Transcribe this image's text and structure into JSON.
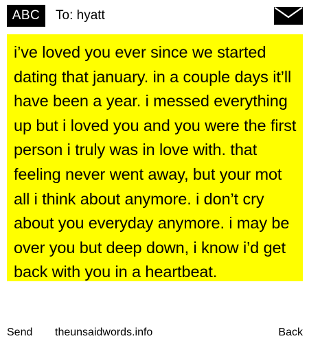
{
  "header": {
    "mode_badge": "ABC",
    "recipient": "To: hyatt",
    "send_icon": "envelope-icon"
  },
  "message": {
    "body": "i’ve loved you ever since we started dating that january. in a couple days it’ll have been a year. i messed everything up but i loved you and you were the first person i truly was in love with. that feeling never went away, but your mot all i think about anymore. i don’t cry about you everyday anymore. i may be over you but deep down, i know i’d get back with you in a heartbeat.",
    "highlight_color": "#ffff00"
  },
  "footer": {
    "send_label": "Send",
    "site_label": "theunsaidwords.info",
    "back_label": "Back"
  }
}
